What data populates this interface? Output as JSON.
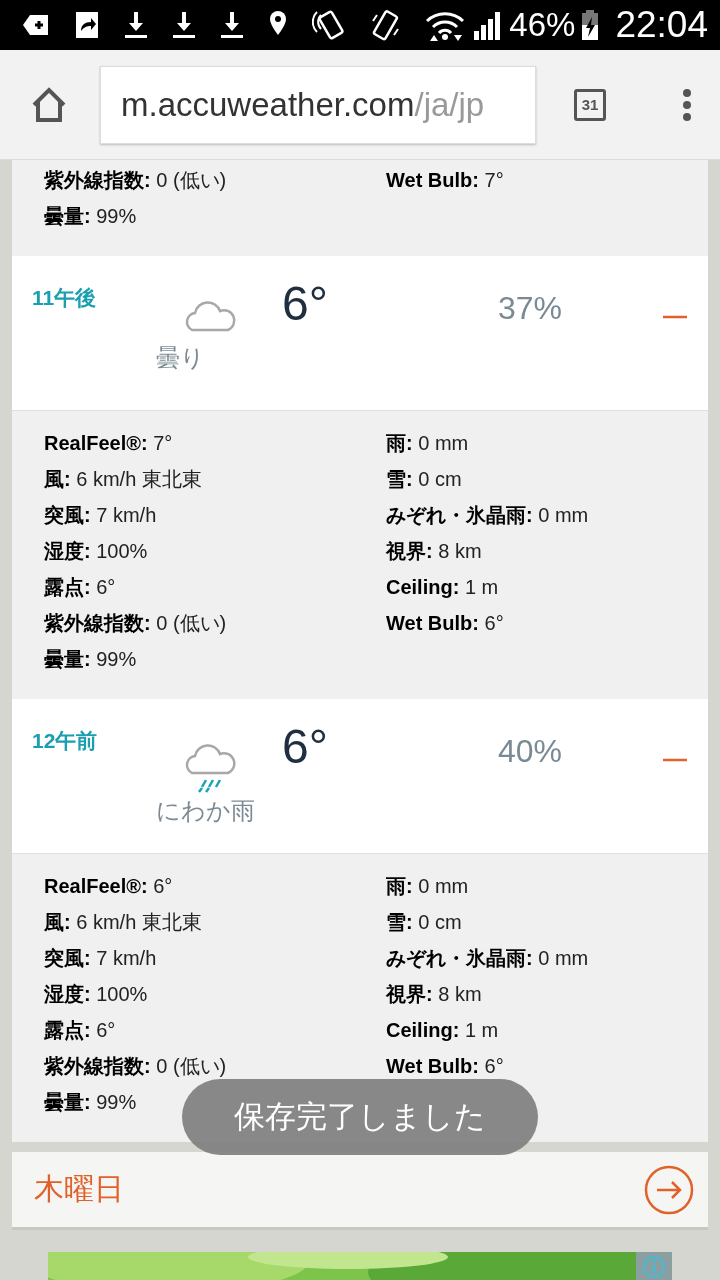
{
  "status_bar": {
    "battery": "46%",
    "time": "22:04"
  },
  "browser": {
    "url_host": "m.accuweather.com",
    "url_path": "/ja/jp",
    "tabs_count": "31"
  },
  "top_details": {
    "left": [
      "**紫外線指数:** 0 (低い)",
      "**曇量:** 99%"
    ],
    "right": [
      "**Wet Bulb:** 7°"
    ]
  },
  "hours": [
    {
      "time": "11午後",
      "kind": "cloudy",
      "condition": "曇り",
      "temp": "6°",
      "precip": "37%",
      "expanded": true,
      "left": [
        "**RealFeel®:** 7°",
        "**風:** 6 km/h 東北東",
        "**突風:** 7 km/h",
        "**湿度:** 100%",
        "**露点:** 6°",
        "**紫外線指数:** 0 (低い)",
        "**曇量:** 99%"
      ],
      "right": [
        "**雨:** 0 mm",
        "**雪:** 0 cm",
        "**みぞれ・氷晶雨:** 0 mm",
        "**視界:** 8 km",
        "**Ceiling:** 1 m",
        "**Wet Bulb:** 6°"
      ]
    },
    {
      "time": "12午前",
      "kind": "showers",
      "condition": "にわか雨",
      "temp": "6°",
      "precip": "40%",
      "expanded": true,
      "left": [
        "**RealFeel®:** 6°",
        "**風:** 6 km/h 東北東",
        "**突風:** 7 km/h",
        "**湿度:** 100%",
        "**露点:** 6°",
        "**紫外線指数:** 0 (低い)",
        "**曇量:** 99%"
      ],
      "right": [
        "**雨:** 0 mm",
        "**雪:** 0 cm",
        "**みぞれ・氷晶雨:** 0 mm",
        "**視界:** 8 km",
        "**Ceiling:** 1 m",
        "**Wet Bulb:** 6°"
      ]
    }
  ],
  "next_day": {
    "label": "木曜日"
  },
  "toast": {
    "text": "保存完了しました"
  }
}
